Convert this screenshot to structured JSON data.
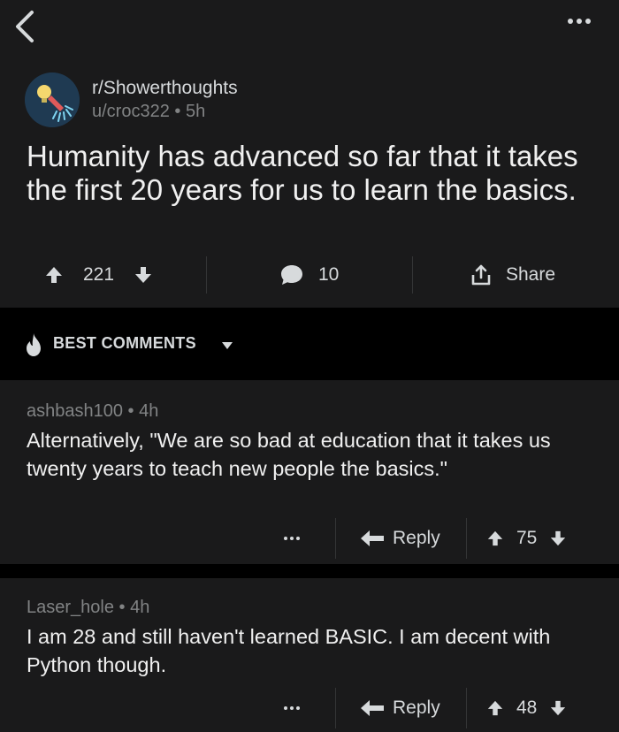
{
  "post": {
    "subreddit": "r/Showerthoughts",
    "author": "u/croc322",
    "age": "5h",
    "title": "Humanity has advanced so far that it takes the first 20 years for us to learn the basics.",
    "score": "221",
    "comment_count": "10",
    "share_label": "Share"
  },
  "comments_section": {
    "sort_label": "BEST COMMENTS"
  },
  "comments": [
    {
      "author": "ashbash100",
      "age": "4h",
      "body": "Alternatively, \"We are so bad at education that it takes us twenty years to teach new people the basics.\"",
      "reply_label": "Reply",
      "score": "75"
    },
    {
      "author": "Laser_hole",
      "age": "4h",
      "body": "I am 28 and still haven't learned BASIC. I am decent with Python though.",
      "reply_label": "Reply",
      "score": "48"
    }
  ],
  "separator": "•",
  "icons": {
    "back": "chevron-left-icon",
    "more": "more-horizontal-icon",
    "upvote": "arrow-up-icon",
    "downvote": "arrow-down-icon",
    "comment": "comment-bubble-icon",
    "share": "share-icon",
    "best": "flame-icon",
    "sort": "caret-down-icon",
    "reply": "reply-arrow-icon"
  },
  "colors": {
    "background": "#000000",
    "card": "#1a1a1b",
    "text": "#f0f0f0",
    "meta": "#818384"
  }
}
